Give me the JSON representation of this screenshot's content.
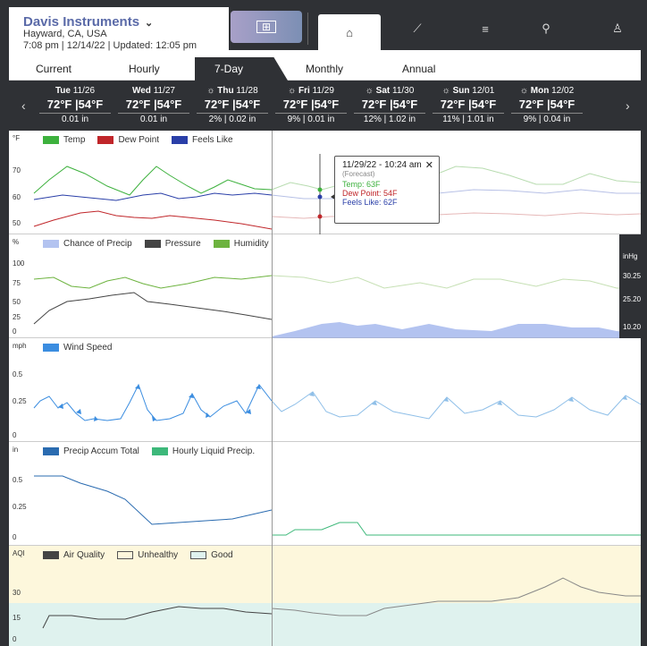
{
  "header": {
    "title": "Davis Instruments",
    "location": "Hayward, CA, USA",
    "updated": "7:08 pm | 12/14/22 | Updated: 12:05 pm"
  },
  "nav": {
    "icons": [
      "dashboard-icon",
      "home-icon",
      "chart-icon",
      "list-icon",
      "location-pin-icon",
      "user-icon"
    ]
  },
  "tabs": [
    "Current",
    "Hourly",
    "7-Day",
    "Monthly",
    "Annual"
  ],
  "active_tab": "7-Day",
  "days": [
    {
      "name": "Tue",
      "date": "11/26",
      "temps": "72°F |54°F",
      "precip": "0.01 in",
      "sun": ""
    },
    {
      "name": "Wed",
      "date": "11/27",
      "temps": "72°F |54°F",
      "precip": "0.01 in",
      "sun": ""
    },
    {
      "name": "Thu",
      "date": "11/28",
      "temps": "72°F |54°F",
      "precip": "2% | 0.02 in",
      "sun": "☼"
    },
    {
      "name": "Fri",
      "date": "11/29",
      "temps": "72°F |54°F",
      "precip": "9% | 0.01 in",
      "sun": "☼"
    },
    {
      "name": "Sat",
      "date": "11/30",
      "temps": "72°F |54°F",
      "precip": "12% | 1.02 in",
      "sun": "☼"
    },
    {
      "name": "Sun",
      "date": "12/01",
      "temps": "72°F |54°F",
      "precip": "11% | 1.01 in",
      "sun": "☼"
    },
    {
      "name": "Mon",
      "date": "12/02",
      "temps": "72°F |54°F",
      "precip": "9% | 0.04 in",
      "sun": "☼"
    }
  ],
  "panels": {
    "temp": {
      "unit": "°F",
      "ticks": [
        "70",
        "60",
        "50"
      ],
      "legend": [
        "Temp",
        "Dew Point",
        "Feels Like"
      ],
      "colors": [
        "#3db13d",
        "#c0262a",
        "#2a3fa8"
      ]
    },
    "precip": {
      "unit": "%",
      "ticks": [
        "100",
        "75",
        "50",
        "25",
        "0"
      ],
      "legend": [
        "Chance of Precip",
        "Pressure",
        "Humidity"
      ],
      "colors": [
        "#b3c3f0",
        "#444444",
        "#6db33f"
      ],
      "right_unit": "inHg",
      "right_ticks": [
        "30.25",
        "25.20",
        "10.20"
      ]
    },
    "wind": {
      "unit": "mph",
      "ticks": [
        "0.5",
        "0.25",
        "0"
      ],
      "legend": [
        "Wind Speed"
      ],
      "colors": [
        "#3b8de0"
      ]
    },
    "rain": {
      "unit": "in",
      "ticks": [
        "0.5",
        "0.25",
        "0"
      ],
      "legend": [
        "Precip Accum Total",
        "Hourly Liquid Precip."
      ],
      "colors": [
        "#2a6bb0",
        "#3db87a"
      ]
    },
    "aqi": {
      "unit": "AQI",
      "ticks": [
        "30",
        "15",
        "0"
      ],
      "legend": [
        "Air Quality",
        "Unhealthy",
        "Good"
      ],
      "colors": [
        "#444444",
        "#fdf7dc",
        "#dff2ee"
      ]
    }
  },
  "tooltip": {
    "title": "11/29/22 - 10:24 am",
    "sub": "(Forecast)",
    "temp": "Temp: 63F",
    "dew": "Dew Point: 54F",
    "feels": "Feels Like: 62F"
  }
}
